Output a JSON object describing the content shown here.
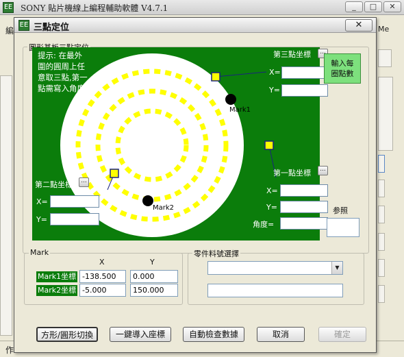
{
  "main_window": {
    "title": "SONY 貼片機線上編程輔助軟體 V4.7.1",
    "app_icon": "app-logo-icon",
    "app_icon_glyph": "EE",
    "controls": {
      "minimize": "_",
      "maximize": "□",
      "close": "✕"
    },
    "right_fragment": "Me",
    "left_fragment": "編",
    "status_fragment": "作"
  },
  "dialog": {
    "title": "三點定位",
    "close_glyph": "✕",
    "icon_glyph": "EE",
    "board_group_label": "圓形基板三點定位",
    "hint_lines": [
      "提示: 在最外",
      "圍的圓周上任",
      "意取三點,第一",
      "點需寫入角度"
    ],
    "point3": {
      "label": "第三點坐標",
      "x_label": "X=",
      "y_label": "Y=",
      "x": "",
      "y": ""
    },
    "point2": {
      "label": "第二點坐標",
      "x_label": "X=",
      "y_label": "Y=",
      "x": "",
      "y": ""
    },
    "point1": {
      "label": "第一點坐標",
      "x_label": "X=",
      "y_label": "Y=",
      "angle_label": "角度=",
      "x": "",
      "y": "",
      "angle": ""
    },
    "pick_glyph": "...",
    "mark1_label": "Mark1",
    "mark2_label": "Mark2",
    "input_count_button": "輸入每\n圈點數",
    "reference_label": "参照",
    "reference_value": "",
    "mark_group": {
      "label": "Mark",
      "col_x": "X",
      "col_y": "Y",
      "rows": [
        {
          "label": "Mark1坐標",
          "x": "-138.500",
          "y": "0.000"
        },
        {
          "label": "Mark2坐標",
          "x": "-5.000",
          "y": "150.000"
        }
      ]
    },
    "part_group": {
      "label": "零件料號選擇",
      "combo_value": "",
      "combo_arrow": "▼",
      "text_value": ""
    },
    "buttons": {
      "toggle_shape": "方形/圓形切換",
      "import_coords": "一鍵導入座標",
      "auto_check": "自動檢查數據",
      "cancel": "取消",
      "confirm": "確定"
    },
    "colors": {
      "panel_green": "#0b7d0b",
      "dots": "#ffff00",
      "button_green": "#7de07d"
    }
  }
}
